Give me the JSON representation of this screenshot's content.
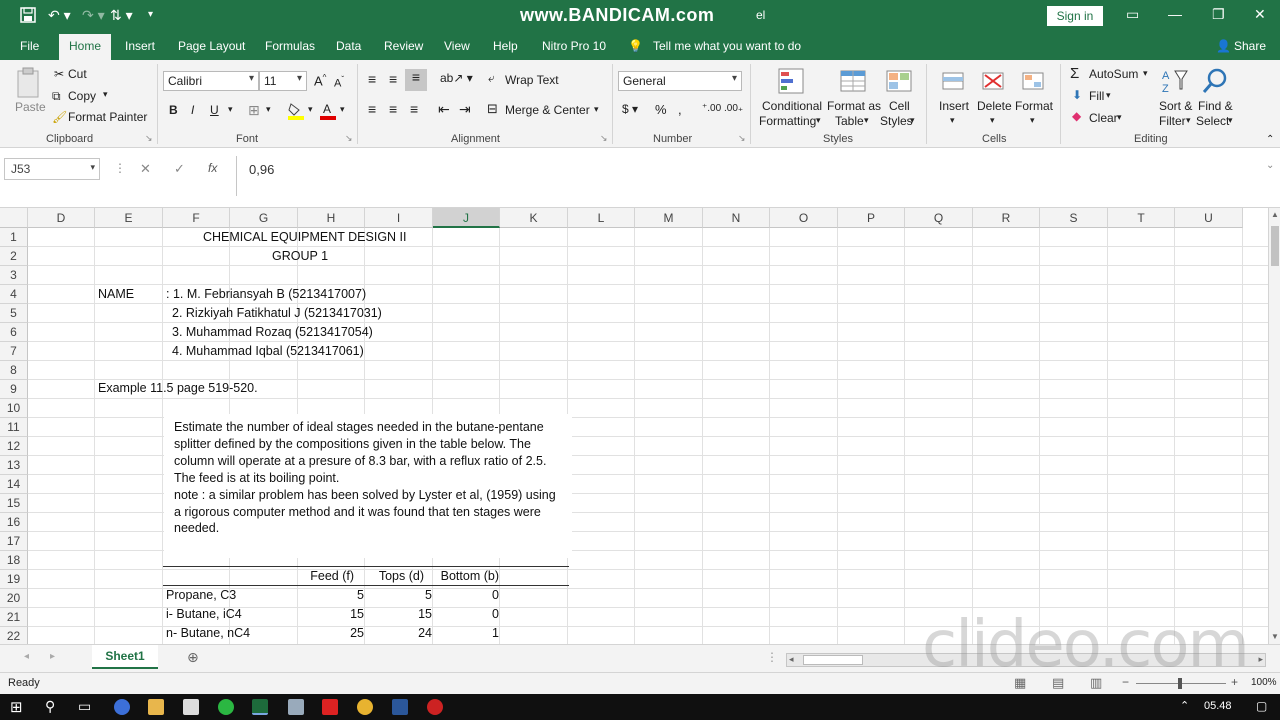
{
  "titlebar": {
    "title": "www.BANDICAM.com",
    "title_suffix": "el",
    "signin": "Sign in"
  },
  "tabs": [
    "File",
    "Home",
    "Insert",
    "Page Layout",
    "Formulas",
    "Data",
    "Review",
    "View",
    "Help",
    "Nitro Pro 10"
  ],
  "tell_me": "Tell me what you want to do",
  "share": "Share",
  "ribbon": {
    "clipboard": {
      "paste": "Paste",
      "cut": "Cut",
      "copy": "Copy",
      "format_painter": "Format Painter",
      "group": "Clipboard"
    },
    "font": {
      "name": "Calibri",
      "size": "11",
      "group": "Font"
    },
    "alignment": {
      "wrap": "Wrap Text",
      "merge": "Merge & Center",
      "group": "Alignment"
    },
    "number": {
      "format": "General",
      "group": "Number"
    },
    "styles": {
      "conditional_1": "Conditional",
      "conditional_2": "Formatting",
      "format_table_1": "Format as",
      "format_table_2": "Table",
      "cell_styles_1": "Cell",
      "cell_styles_2": "Styles",
      "group": "Styles"
    },
    "cells": {
      "insert": "Insert",
      "delete": "Delete",
      "format": "Format",
      "group": "Cells"
    },
    "editing": {
      "autosum": "AutoSum",
      "fill": "Fill",
      "clear": "Clear",
      "sort_1": "Sort &",
      "sort_2": "Filter",
      "find_1": "Find &",
      "find_2": "Select",
      "group": "Editing"
    }
  },
  "formula_bar": {
    "name_box": "J53",
    "fx": "fx",
    "value": "0,96"
  },
  "columns": [
    "D",
    "E",
    "F",
    "G",
    "H",
    "I",
    "J",
    "K",
    "L",
    "M",
    "N",
    "O",
    "P",
    "Q",
    "R",
    "S",
    "T",
    "U"
  ],
  "selected_column": "J",
  "rows": [
    "1",
    "2",
    "3",
    "4",
    "5",
    "6",
    "7",
    "8",
    "9",
    "10",
    "11",
    "12",
    "13",
    "14",
    "15",
    "16",
    "17",
    "18",
    "19",
    "20",
    "21",
    "22"
  ],
  "sheet": {
    "title1": "CHEMICAL EQUIPMENT DESIGN II",
    "title2": "GROUP 1",
    "name_label": "NAME",
    "members": [
      ": 1. M. Febriansyah B (5213417007)",
      "2. Rizkiyah Fatikhatul J (5213417031)",
      "3. Muhammad Rozaq (5213417054)",
      "4. Muhammad Iqbal (5213417061)"
    ],
    "example": "Example 11.5 page 519-520.",
    "problem_lines": [
      "Estimate the number of ideal stages needed in the butane-pentane",
      "splitter defined by the compositions given in the table below. The",
      "column will operate at a presure of 8.3 bar, with a reflux ratio of 2.5.",
      "The feed is at its boiling point.",
      "note : a similar problem has been solved by Lyster et al, (1959) using",
      "a rigorous computer method and it was found that ten stages were",
      "needed."
    ],
    "table_headers": [
      "Feed (f)",
      "Tops (d)",
      "Bottom (b)"
    ],
    "table_rows": [
      {
        "name": "Propane, C3",
        "feed": "5",
        "tops": "5",
        "bottom": "0"
      },
      {
        "name": "i- Butane, iC4",
        "feed": "15",
        "tops": "15",
        "bottom": "0"
      },
      {
        "name": "n- Butane, nC4",
        "feed": "25",
        "tops": "24",
        "bottom": "1"
      }
    ]
  },
  "sheet_tab": "Sheet1",
  "status": {
    "ready": "Ready",
    "zoom": "100%"
  },
  "taskbar": {
    "time": "05.48"
  },
  "watermark": "clideo.com"
}
